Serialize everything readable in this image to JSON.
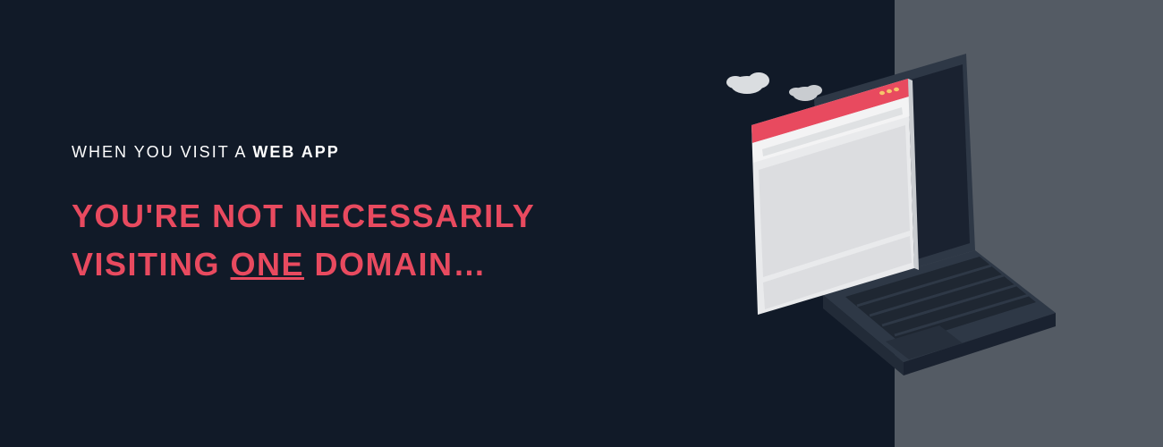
{
  "colors": {
    "bg_dark": "#111a28",
    "bg_panel": "#545b64",
    "accent": "#e84a5f",
    "white": "#ffffff"
  },
  "text": {
    "intro_prefix": "WHEN YOU VISIT A ",
    "intro_bold": "WEB APP",
    "headline_l1": "YOU'RE NOT NECESSARILY",
    "headline_l2a": "VISITING ",
    "headline_l2b": "ONE",
    "headline_l2c": " DOMAIN…"
  },
  "illustration": {
    "name": "laptop-with-browser-window",
    "elements": [
      "cloud-icon",
      "cloud-icon",
      "laptop",
      "browser-window"
    ]
  }
}
